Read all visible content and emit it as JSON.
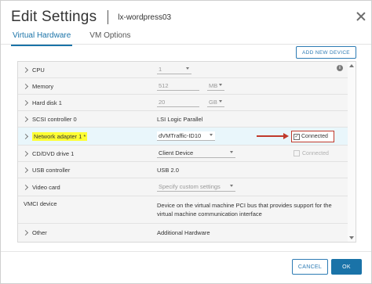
{
  "dialog": {
    "title": "Edit Settings",
    "vm_name": "lx-wordpress03"
  },
  "tabs": [
    {
      "label": "Virtual Hardware",
      "active": true
    },
    {
      "label": "VM Options",
      "active": false
    }
  ],
  "toolbar": {
    "add_device_label": "ADD NEW DEVICE"
  },
  "hardware": {
    "cpu": {
      "label": "CPU",
      "value": "1"
    },
    "memory": {
      "label": "Memory",
      "value": "512",
      "unit": "MB"
    },
    "hard_disk": {
      "label": "Hard disk 1",
      "value": "20",
      "unit": "GB"
    },
    "scsi": {
      "label": "SCSI controller 0",
      "value": "LSI Logic Parallel"
    },
    "network": {
      "label": "Network adapter 1 *",
      "value": "dVMTraffic-ID10",
      "connected_label": "Connected",
      "connected": true
    },
    "cd_dvd": {
      "label": "CD/DVD drive 1",
      "value": "Client Device",
      "connected_label": "Connected",
      "connected": false
    },
    "usb": {
      "label": "USB controller",
      "value": "USB 2.0"
    },
    "video": {
      "label": "Video card",
      "value": "Specify custom settings"
    },
    "vmci": {
      "label": "VMCI device",
      "value_line1": "Device on the virtual machine PCI bus that provides support for the",
      "value_line2": "virtual machine communication interface"
    },
    "other": {
      "label": "Other",
      "value": "Additional Hardware"
    }
  },
  "footer": {
    "cancel_label": "CANCEL",
    "ok_label": "OK"
  },
  "colors": {
    "accent": "#1a73a8",
    "highlight": "#ffff33",
    "annotation": "#c0392b"
  }
}
